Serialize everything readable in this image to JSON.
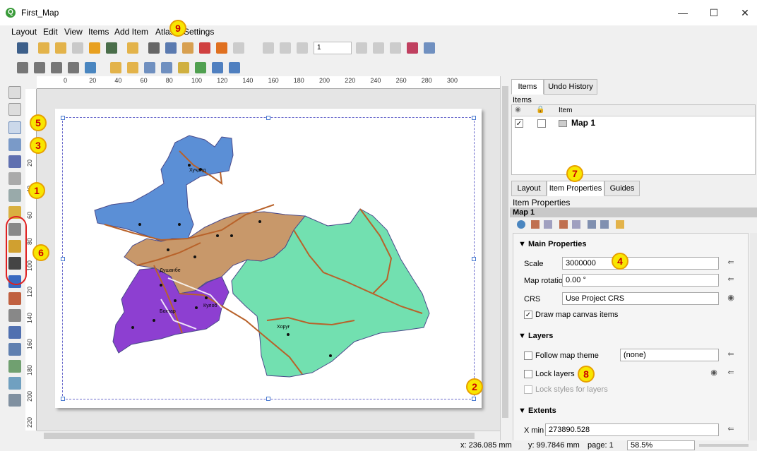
{
  "window": {
    "title": "First_Map",
    "min": "—",
    "max": "☐",
    "close": "✕"
  },
  "menu": [
    "Layout",
    "Edit",
    "View",
    "Items",
    "Add Item",
    "Atlas",
    "Settings"
  ],
  "toolbar": {
    "page_value": "1"
  },
  "ruler_h": [
    "0",
    "20",
    "40",
    "60",
    "80",
    "100",
    "120",
    "140",
    "160",
    "180",
    "200",
    "220",
    "240",
    "260",
    "280",
    "300"
  ],
  "ruler_v": [
    "20",
    "40",
    "60",
    "80",
    "100",
    "120",
    "140",
    "160",
    "180",
    "200",
    "220"
  ],
  "map": {
    "cities": [
      "Хуҷанд",
      "Душанбе",
      "Бохтар",
      "Кулоб",
      "Хоруғ"
    ],
    "colors": {
      "sughd": "#5b8fd6",
      "rrs": "#c8986a",
      "khatlon": "#8d3fd1",
      "gbao": "#72e0b0",
      "roads": "#b8622a"
    }
  },
  "right_panel": {
    "top_tabs": [
      "Items",
      "Undo History"
    ],
    "items_title": "Items",
    "items_header": "Item",
    "items": [
      {
        "name": "Map 1",
        "visible": "✓"
      }
    ],
    "tabs": [
      "Layout",
      "Item Properties",
      "Guides"
    ],
    "props_title": "Item Properties",
    "item_name": "Map 1",
    "main_props": "Main Properties",
    "scale_label": "Scale",
    "scale_value": "3000000",
    "rotation_label": "Map rotation",
    "rotation_value": "0.00 °",
    "crs_label": "CRS",
    "crs_value": "Use Project CRS",
    "draw_canvas": "Draw map canvas items",
    "layers_section": "Layers",
    "follow_theme": "Follow map theme",
    "theme_value": "(none)",
    "lock_layers": "Lock layers",
    "lock_styles": "Lock styles for layers",
    "extents_section": "Extents",
    "xmin_label": "X min",
    "xmin_value": "273890.528"
  },
  "status": {
    "x": "x: 236.085 mm",
    "y": "y: 99.7846 mm",
    "page": "page: 1",
    "zoom": "58.5%"
  },
  "badges": {
    "b1": "1",
    "b2": "2",
    "b3": "3",
    "b4": "4",
    "b5": "5",
    "b6": "6",
    "b7": "7",
    "b8": "8",
    "b9": "9"
  }
}
